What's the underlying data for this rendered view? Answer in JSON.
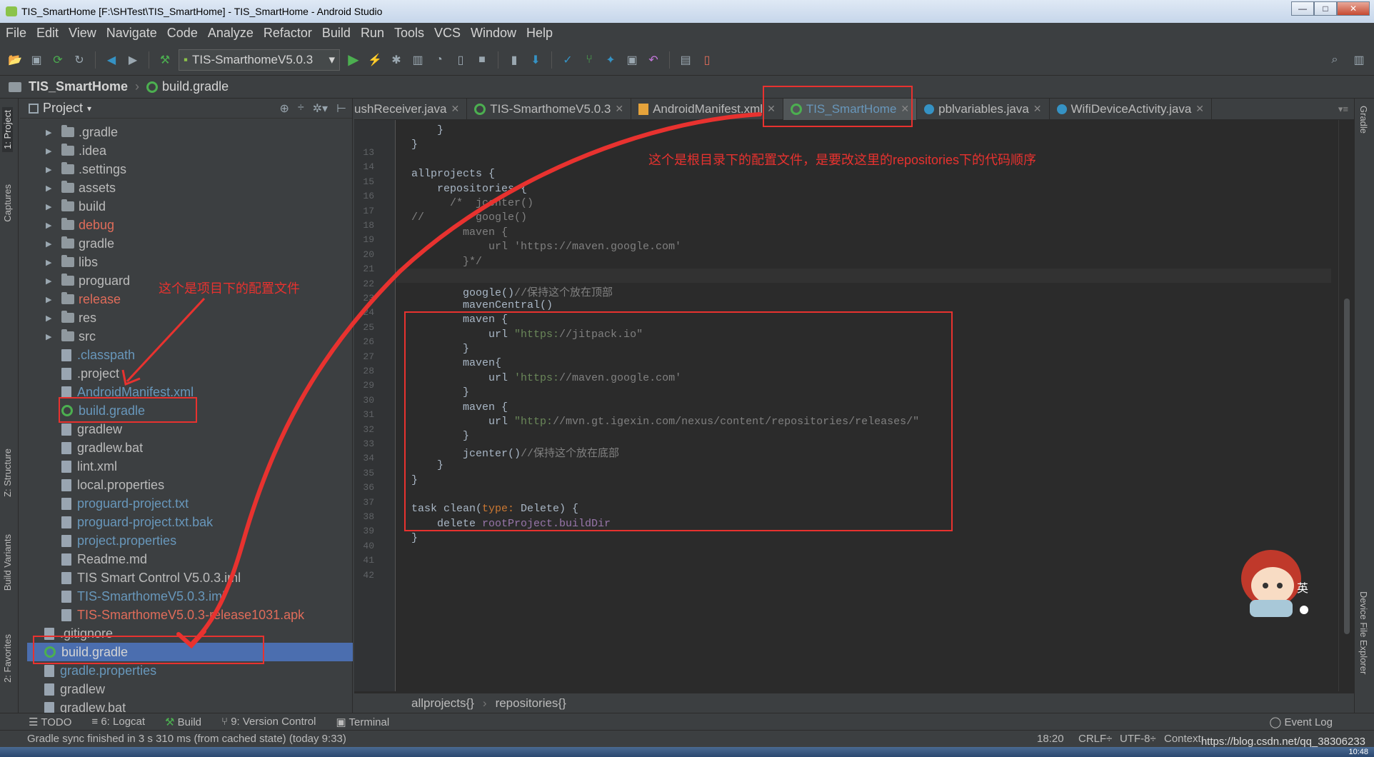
{
  "window": {
    "title": "TIS_SmartHome [F:\\SHTest\\TIS_SmartHome] - TIS_SmartHome - Android Studio",
    "minimize": "—",
    "maximize": "□",
    "close": "✕"
  },
  "menu": [
    "File",
    "Edit",
    "View",
    "Navigate",
    "Code",
    "Analyze",
    "Refactor",
    "Build",
    "Run",
    "Tools",
    "VCS",
    "Window",
    "Help"
  ],
  "toolbar": {
    "run_config": "TIS-SmarthomeV5.0.3",
    "icons": [
      "open-icon",
      "save-icon",
      "sync-icon",
      "refresh-icon",
      "back-icon",
      "forward-icon",
      "hammer-icon",
      "run-icon",
      "apply-changes-icon",
      "debug-icon",
      "profile-icon",
      "attach-debugger-icon",
      "coverage-icon",
      "stop-icon",
      "avd-icon",
      "sdk-icon",
      "gradle-sync-icon",
      "layout-inspector-icon",
      "device-monitor-icon",
      "undo-icon",
      "project-structure-icon",
      "device-file-icon",
      "search-icon"
    ]
  },
  "navbar": {
    "project": "TIS_SmartHome",
    "file": "build.gradle"
  },
  "left_stripe": [
    "1: Project",
    "Captures",
    "Z: Structure",
    "Build Variants",
    "2: Favorites"
  ],
  "right_stripe": [
    "Gradle",
    "Device File Explorer"
  ],
  "project_panel": {
    "title": "Project",
    "items": [
      {
        "label": ".gradle",
        "kind": "folder",
        "color": "#bbbbbb"
      },
      {
        "label": ".idea",
        "kind": "folder",
        "color": "#bbbbbb"
      },
      {
        "label": ".settings",
        "kind": "folder",
        "color": "#bbbbbb"
      },
      {
        "label": "assets",
        "kind": "folder",
        "color": "#bbbbbb"
      },
      {
        "label": "build",
        "kind": "folder",
        "color": "#bbbbbb"
      },
      {
        "label": "debug",
        "kind": "folder",
        "color": "#e06c5a"
      },
      {
        "label": "gradle",
        "kind": "folder",
        "color": "#bbbbbb"
      },
      {
        "label": "libs",
        "kind": "folder",
        "color": "#bbbbbb"
      },
      {
        "label": "proguard",
        "kind": "folder",
        "color": "#bbbbbb"
      },
      {
        "label": "release",
        "kind": "folder",
        "color": "#e06c5a"
      },
      {
        "label": "res",
        "kind": "folder",
        "color": "#bbbbbb"
      },
      {
        "label": "src",
        "kind": "folder",
        "color": "#bbbbbb"
      },
      {
        "label": ".classpath",
        "kind": "file",
        "color": "#6897bb"
      },
      {
        "label": ".project",
        "kind": "file",
        "color": "#bbbbbb"
      },
      {
        "label": "AndroidManifest.xml",
        "kind": "file",
        "color": "#6897bb"
      },
      {
        "label": "build.gradle",
        "kind": "gradle",
        "color": "#6897bb"
      },
      {
        "label": "gradlew",
        "kind": "file",
        "color": "#bbbbbb"
      },
      {
        "label": "gradlew.bat",
        "kind": "file",
        "color": "#bbbbbb"
      },
      {
        "label": "lint.xml",
        "kind": "file",
        "color": "#bbbbbb"
      },
      {
        "label": "local.properties",
        "kind": "file",
        "color": "#bbbbbb"
      },
      {
        "label": "proguard-project.txt",
        "kind": "file",
        "color": "#6897bb"
      },
      {
        "label": "proguard-project.txt.bak",
        "kind": "file",
        "color": "#6897bb"
      },
      {
        "label": "project.properties",
        "kind": "file",
        "color": "#6897bb"
      },
      {
        "label": "Readme.md",
        "kind": "file",
        "color": "#bbbbbb"
      },
      {
        "label": "TIS Smart Control V5.0.3.iml",
        "kind": "file",
        "color": "#bbbbbb"
      },
      {
        "label": "TIS-SmarthomeV5.0.3.iml",
        "kind": "file",
        "color": "#6897bb"
      },
      {
        "label": "TIS-SmarthomeV5.0.3-release1031.apk",
        "kind": "file",
        "color": "#e06c5a"
      }
    ],
    "root_items": [
      {
        "label": ".gitignore",
        "kind": "file",
        "color": "#bbbbbb"
      },
      {
        "label": "build.gradle",
        "kind": "gradle",
        "color": "#d4d4d4",
        "selected": true
      },
      {
        "label": "gradle.properties",
        "kind": "file",
        "color": "#6897bb"
      },
      {
        "label": "gradlew",
        "kind": "file",
        "color": "#bbbbbb"
      },
      {
        "label": "gradlew.bat",
        "kind": "file",
        "color": "#bbbbbb"
      }
    ]
  },
  "tabs": [
    {
      "label": "ushReceiver.java",
      "icon": "java-class-icon"
    },
    {
      "label": "TIS-SmarthomeV5.0.3",
      "icon": "gradle-icon"
    },
    {
      "label": "AndroidManifest.xml",
      "icon": "xml-icon"
    },
    {
      "label": "TIS_SmartHome",
      "icon": "gradle-icon",
      "active": true
    },
    {
      "label": "pblvariables.java",
      "icon": "java-class-icon"
    },
    {
      "label": "WifiDeviceActivity.java",
      "icon": "java-class-icon"
    }
  ],
  "code": {
    "lines": [
      {
        "n": "13",
        "text": "    }"
      },
      {
        "n": "14",
        "text": "}"
      },
      {
        "n": "15",
        "text": ""
      },
      {
        "n": "16",
        "text": "allprojects {"
      },
      {
        "n": "17",
        "text": "    repositories {"
      },
      {
        "n": "18",
        "text": "      /*  jcenter()"
      },
      {
        "n": "19",
        "text": "//        google()"
      },
      {
        "n": "20",
        "text": "        maven {"
      },
      {
        "n": "21",
        "text": "            url 'https://maven.google.com'"
      },
      {
        "n": "22",
        "text": "        }*/"
      },
      {
        "n": "23",
        "text": ""
      },
      {
        "n": "24",
        "text": "        google()//保持这个放在顶部"
      },
      {
        "n": "25",
        "text": "        mavenCentral()"
      },
      {
        "n": "26",
        "text": "        maven {"
      },
      {
        "n": "27",
        "text": "            url \"https://jitpack.io\""
      },
      {
        "n": "28",
        "text": "        }"
      },
      {
        "n": "29",
        "text": "        maven{"
      },
      {
        "n": "30",
        "text": "            url 'https://maven.google.com'"
      },
      {
        "n": "31",
        "text": "        }"
      },
      {
        "n": "32",
        "text": "        maven {"
      },
      {
        "n": "33",
        "text": "            url \"http://mvn.gt.igexin.com/nexus/content/repositories/releases/\""
      },
      {
        "n": "34",
        "text": "        }"
      },
      {
        "n": "35",
        "text": "        jcenter()//保持这个放在底部"
      },
      {
        "n": "36",
        "text": "    }"
      },
      {
        "n": "37",
        "text": "}"
      },
      {
        "n": "38",
        "text": ""
      },
      {
        "n": "39",
        "text": "task clean(type: Delete) {"
      },
      {
        "n": "40",
        "text": "    delete rootProject.buildDir"
      },
      {
        "n": "41",
        "text": "}"
      },
      {
        "n": "42",
        "text": ""
      }
    ]
  },
  "editor_breadcrumb": [
    "allprojects{}",
    "repositories{}"
  ],
  "tool_windows": [
    {
      "label": "TODO",
      "icon": "todo-icon"
    },
    {
      "label": "6: Logcat",
      "icon": "logcat-icon"
    },
    {
      "label": "Build",
      "icon": "build-icon"
    },
    {
      "label": "9: Version Control",
      "icon": "vcs-icon"
    },
    {
      "label": "Terminal",
      "icon": "terminal-icon"
    }
  ],
  "event_log": "Event Log",
  "status": {
    "message": "Gradle sync finished in 3 s 310 ms (from cached state) (today 9:33)",
    "position": "18:20",
    "line_sep": "CRLF÷",
    "encoding": "UTF-8÷",
    "context": "Context:"
  },
  "annotations": {
    "root_note": "这个是根目录下的配置文件，是要改这里的repositories下的代码顺序",
    "project_note": "这个是项目下的配置文件",
    "color": "#e8322f"
  },
  "watermark": "https://blog.csdn.net/qq_38306233",
  "clock": "10:48",
  "ime": "英"
}
